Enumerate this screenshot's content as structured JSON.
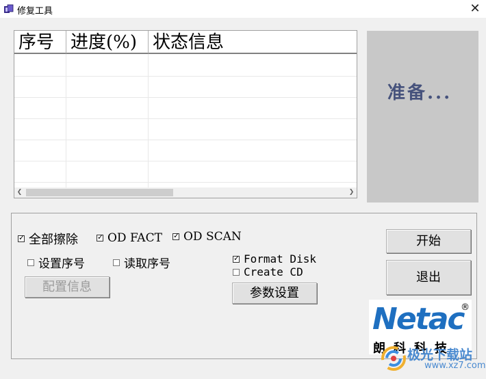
{
  "window": {
    "title": "修复工具",
    "close_glyph": "✕"
  },
  "table": {
    "columns": [
      "序号",
      "进度(%)",
      "状态信息"
    ],
    "rows": []
  },
  "status": {
    "text": "准备..."
  },
  "options": {
    "full_erase": {
      "label": "全部擦除",
      "checked": true
    },
    "od_fact": {
      "label": "OD FACT",
      "checked": true
    },
    "od_scan": {
      "label": "OD SCAN",
      "checked": true
    },
    "set_serial": {
      "label": "设置序号",
      "checked": false
    },
    "read_serial": {
      "label": "读取序号",
      "checked": false
    },
    "format_disk": {
      "label": "Format Disk",
      "checked": true
    },
    "create_cd": {
      "label": "Create CD",
      "checked": false
    }
  },
  "buttons": {
    "config_info": "配置信息",
    "param_settings": "参数设置",
    "start": "开始",
    "exit": "退出"
  },
  "logo": {
    "brand": "Netac",
    "reg": "®",
    "chinese": "朗科科技"
  },
  "watermark": {
    "text": "极光下载站",
    "url": "www.xz7.com"
  }
}
